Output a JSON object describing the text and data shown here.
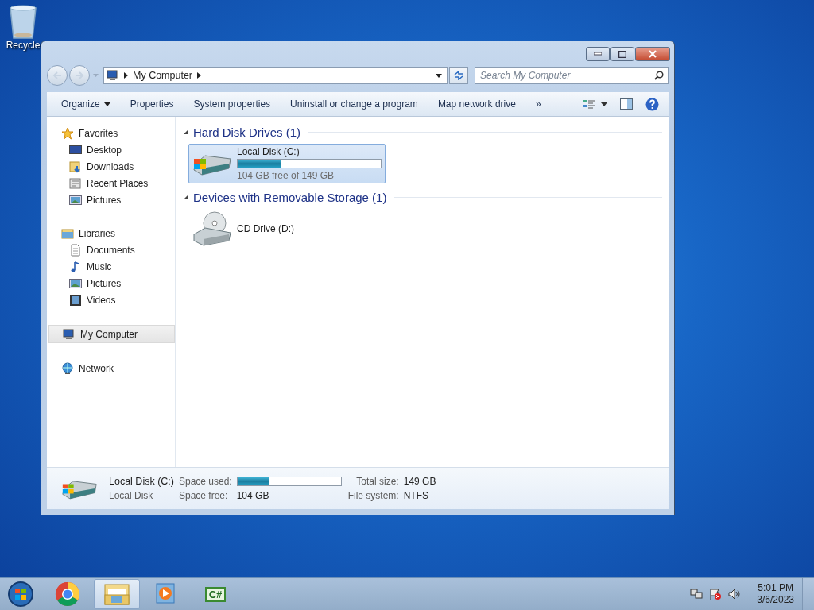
{
  "desktop_icons": [
    {
      "label": "Recycle"
    }
  ],
  "window": {
    "address": {
      "path": "My Computer"
    },
    "search": {
      "placeholder": "Search My Computer"
    },
    "toolbar": [
      {
        "label": "Organize",
        "dropdown": true
      },
      {
        "label": "Properties",
        "dropdown": false
      },
      {
        "label": "System properties",
        "dropdown": false
      },
      {
        "label": "Uninstall or change a program",
        "dropdown": false
      },
      {
        "label": "Map network drive",
        "dropdown": false
      },
      {
        "label": "»",
        "dropdown": false
      }
    ],
    "nav": [
      {
        "label": "Favorites",
        "kind": "star",
        "selected": false,
        "children": [
          {
            "label": "Desktop",
            "kind": "desktop",
            "selected": false
          },
          {
            "label": "Downloads",
            "kind": "folder",
            "selected": false
          },
          {
            "label": "Recent Places",
            "kind": "recent",
            "selected": false
          },
          {
            "label": "Pictures",
            "kind": "picture",
            "selected": false
          }
        ]
      },
      {
        "label": "Libraries",
        "kind": "library",
        "selected": false,
        "children": [
          {
            "label": "Documents",
            "kind": "document",
            "selected": false
          },
          {
            "label": "Music",
            "kind": "music",
            "selected": false
          },
          {
            "label": "Pictures",
            "kind": "picture",
            "selected": false
          },
          {
            "label": "Videos",
            "kind": "video",
            "selected": false
          }
        ]
      },
      {
        "label": "My Computer",
        "kind": "computer",
        "selected": true
      },
      {
        "label": "Network",
        "kind": "network",
        "selected": false
      }
    ],
    "sections": [
      {
        "title": "Hard Disk Drives (1)",
        "items": [
          {
            "name": "Local Disk (C:)",
            "kind": "hdd",
            "selected": true,
            "level": 0.3,
            "info": "104 GB free of 149 GB"
          }
        ]
      },
      {
        "title": "Devices with Removable Storage (1)",
        "items": [
          {
            "name": "CD Drive (D:)",
            "kind": "cd",
            "selected": false
          }
        ]
      }
    ],
    "details": {
      "name": "Local Disk (C:)",
      "type": "Local Disk",
      "space_used_label": "Space used:",
      "level": 0.3,
      "space_free_label": "Space free:",
      "space_free": "104 GB",
      "total_size_label": "Total size:",
      "total_size": "149 GB",
      "file_system_label": "File system:",
      "file_system": "NTFS"
    }
  },
  "taskbar": {
    "apps": [
      {
        "kind": "chrome",
        "selected": false
      },
      {
        "kind": "explorer",
        "selected": true
      },
      {
        "kind": "media",
        "selected": false
      },
      {
        "kind": "csharp",
        "selected": false,
        "label": "C#"
      }
    ],
    "clock": {
      "time": "5:01 PM",
      "date": "3/6/2023"
    }
  }
}
